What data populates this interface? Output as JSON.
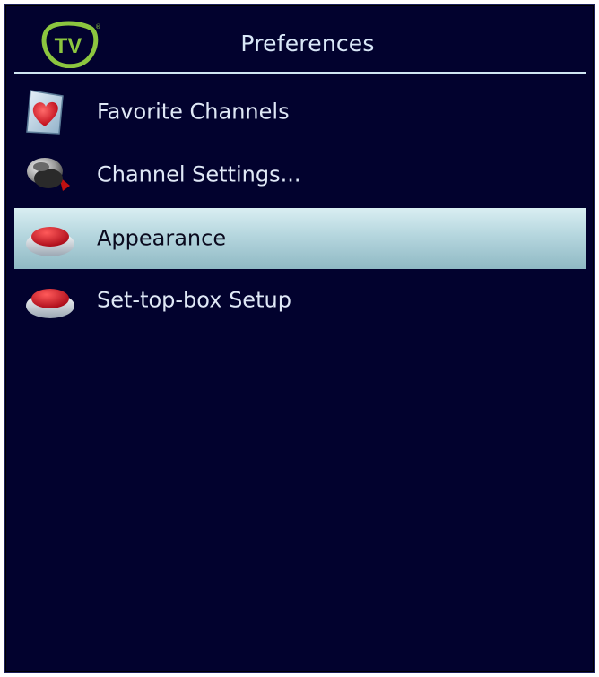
{
  "header": {
    "title": "Preferences",
    "logo_icon": "tv-logo-icon",
    "logo_text": "TV",
    "logo_color": "#8cc63f"
  },
  "menu": {
    "items": [
      {
        "label": "Favorite Channels",
        "icon": "heart-icon",
        "selected": false
      },
      {
        "label": "Channel Settings...",
        "icon": "satellite-dish-icon",
        "selected": false
      },
      {
        "label": "Appearance",
        "icon": "red-button-icon",
        "selected": true
      },
      {
        "label": "Set-top-box Setup",
        "icon": "red-button-icon",
        "selected": false
      }
    ]
  },
  "colors": {
    "background": "#02022e",
    "selection": "#b5d6de",
    "text": "#dfe8f6",
    "accent_red": "#d01818"
  }
}
